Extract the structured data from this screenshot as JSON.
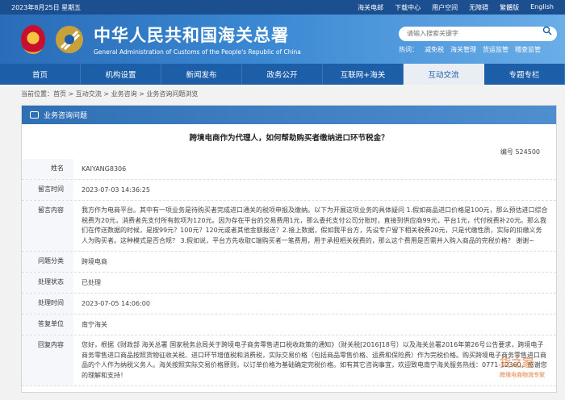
{
  "topbar": {
    "date": "2023年8月25日 星期五",
    "links": [
      "海关电邮",
      "下载中心",
      "用户空间",
      "无障碍",
      "繁體版",
      "English"
    ]
  },
  "header": {
    "title_cn": "中华人民共和国海关总署",
    "title_en": "General Administration of Customs of the People's Republic of China",
    "search_placeholder": "请输入搜索关键字",
    "hot_label": "热词：",
    "hot_words": [
      "减免税",
      "海关管理",
      "货运监管",
      "稽查监管"
    ]
  },
  "nav": {
    "items": [
      "首页",
      "机构设置",
      "新闻发布",
      "政务公开",
      "互联网+海关",
      "互动交流",
      "专题专栏"
    ],
    "active": 5
  },
  "breadcrumb": "当前位置：首页 > 互动交流 > 业务咨询 > 业务咨询问题浏览",
  "panel": {
    "heading": "业务咨询问题",
    "question_title": "跨境电商作为代理人，如何帮助购买者缴纳进口环节税金？",
    "number_label": "编号",
    "number": "524500",
    "fields": [
      {
        "label": "姓名",
        "value": "KAIYANG8306"
      },
      {
        "label": "留言时间",
        "value": "2023-07-03 14:36:25"
      },
      {
        "label": "留言内容",
        "value": "我方作为电商平台。其中有一项业务是待购买者完成进口通关的税项申报及缴纳。以下为开展这项业务的具体疑问 1.假如商品进口价格是100元，那么预估进口综合税费为20元，消费者先支付所有款项为120元。因为存在平台的交易费用1元，那么委托支付公司分账时，直接到供应商99元，平台1元，代付税费补20元。那么我们在传送数据的时候，是按99元？100元？120元或者其他金额报送？2.接上数据，假如我平台方，先设专户留下相关税费20元，只是代缴性质，实际的扣缴义务人为购买者。这种模式是否合规？ 3.假如说，平台方先收取C端购买者一笔费用，用于承担相关税费的，那么这个费用是否需并入购入商品的完税价格？ 谢谢~"
      },
      {
        "label": "问题分类",
        "value": "跨境电商"
      },
      {
        "label": "处理状态",
        "value": "已处理"
      },
      {
        "label": "处理时间",
        "value": "2023-07-05 14:06:00"
      },
      {
        "label": "答复单位",
        "value": "南宁海关"
      },
      {
        "label": "回复内容",
        "value": "您好，根据《财政部 海关总署 国家税务总局关于跨境电子商务零售进口税收政策的通知》（财关税[2016]18号）以及海关总署2016年第26号公告要求，跨境电子商务零售进口商品按照货物征收关税、进口环节增值税和消费税，实际交易价格（包括商品零售价格、运费和保险费）作为完税价格。购买跨境电子商务零售进口商品的个人作为纳税义务人。海关按照实际交易价格原则，以订单价格为基础确定完税价格。如有其它咨询事宜，欢迎致电南宁海关服务热线：0771-12360，感谢您的理解和支持！"
      }
    ]
  },
  "watermark": {
    "text": "货之家",
    "sub": "跨境电商物流专家"
  }
}
